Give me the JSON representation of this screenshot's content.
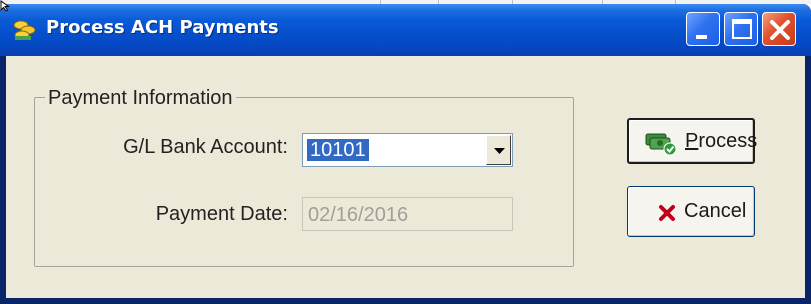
{
  "window": {
    "title": "Process ACH Payments",
    "icon": "coins-app-icon",
    "controls": [
      "minimize-icon",
      "maximize-icon",
      "close-icon"
    ]
  },
  "group": {
    "legend": "Payment Information"
  },
  "fields": {
    "account_label": "G/L Bank Account:",
    "account_value": "10101",
    "date_label": "Payment Date:",
    "date_value": "02/16/2016"
  },
  "buttons": {
    "process_mnemonic": "P",
    "process_rest": "rocess",
    "cancel_label": "Cancel"
  },
  "colors": {
    "titlebar": "#0650cc",
    "client": "#ece9d8",
    "selection": "#316ac5",
    "cancel_x": "#c0001a"
  }
}
